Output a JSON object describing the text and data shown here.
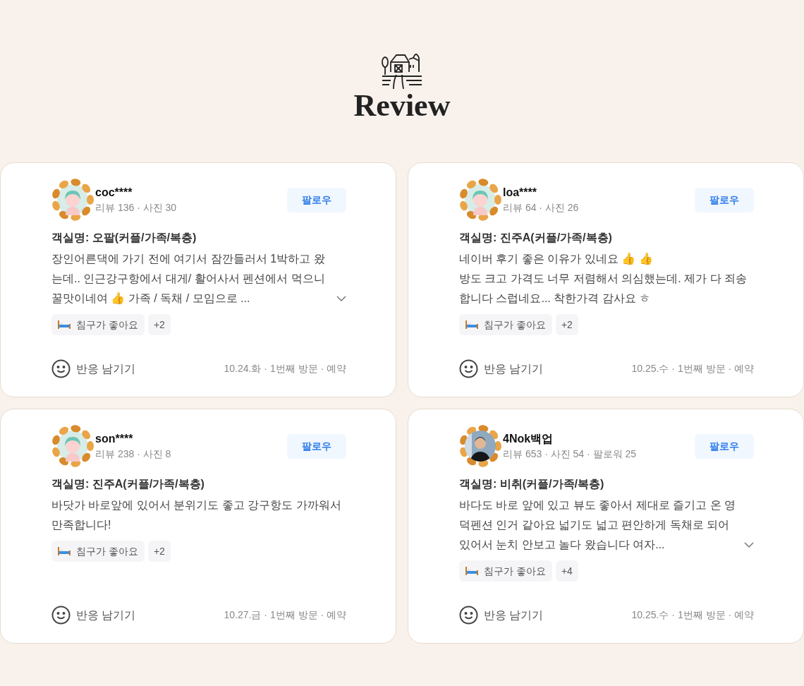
{
  "header": {
    "title": "Review"
  },
  "reviews": [
    {
      "user": "coc****",
      "avatar": {
        "kind": "illustration"
      },
      "stats": "리뷰 136 · 사진 30",
      "follow": "팔로우",
      "room": "객실명: 오팔(커플/가족/복층)",
      "text": "장인어른댁에 가기 전에 여기서 잠깐들러서 1박하고 왔는데.. 인근강구항에서 대게/ 활어사서 펜션에서 먹으니 꿀맛이네여 👍 가족 / 독채 / 모임으로 ...",
      "expandable": true,
      "tag": "침구가 좋아요",
      "more": "+2",
      "react": "반응 남기기",
      "meta": "10.24.화 · 1번째 방문 · 예약"
    },
    {
      "user": "loa****",
      "avatar": {
        "kind": "illustration"
      },
      "stats": "리뷰 64 · 사진 26",
      "follow": "팔로우",
      "room": "객실명: 진주A(커플/가족/복층)",
      "text": "네이버 후기 좋은 이유가 있네요 👍 👍\n방도 크고 가격도 너무 저렴해서 의심했는데. 제가 다 죄송합니다 스럽네요... 착한가격 감사요 ㅎ",
      "expandable": false,
      "tag": "침구가 좋아요",
      "more": "+2",
      "react": "반응 남기기",
      "meta": "10.25.수 · 1번째 방문 · 예약"
    },
    {
      "user": "son****",
      "avatar": {
        "kind": "illustration"
      },
      "stats": "리뷰 238 · 사진 8",
      "follow": "팔로우",
      "room": "객실명: 진주A(커플/가족/복층)",
      "text": "바닷가 바로앞에 있어서 분위기도 좋고 강구항도 가까워서 만족합니다!",
      "expandable": false,
      "tag": "침구가 좋아요",
      "more": "+2",
      "react": "반응 남기기",
      "meta": "10.27.금 · 1번째 방문 · 예약"
    },
    {
      "user": "4Nok백업",
      "stats": "리뷰 653 · 사진 54 · 팔로워 25",
      "follow": "팔로우",
      "room": "객실명: 비취(커플/가족/복층)",
      "text": "바다도 바로 앞에 있고 뷰도 좋아서 제대로 즐기고 온 영덕펜션 인거 같아요 넓기도 넓고 편안하게 독채로 되어 있어서 눈치 안보고 놀다 왔습니다 여자...",
      "expandable": true,
      "tag": "침구가 좋아요",
      "more": "+4",
      "react": "반응 남기기",
      "meta": "10.25.수 · 1번째 방문 · 예약"
    }
  ]
}
